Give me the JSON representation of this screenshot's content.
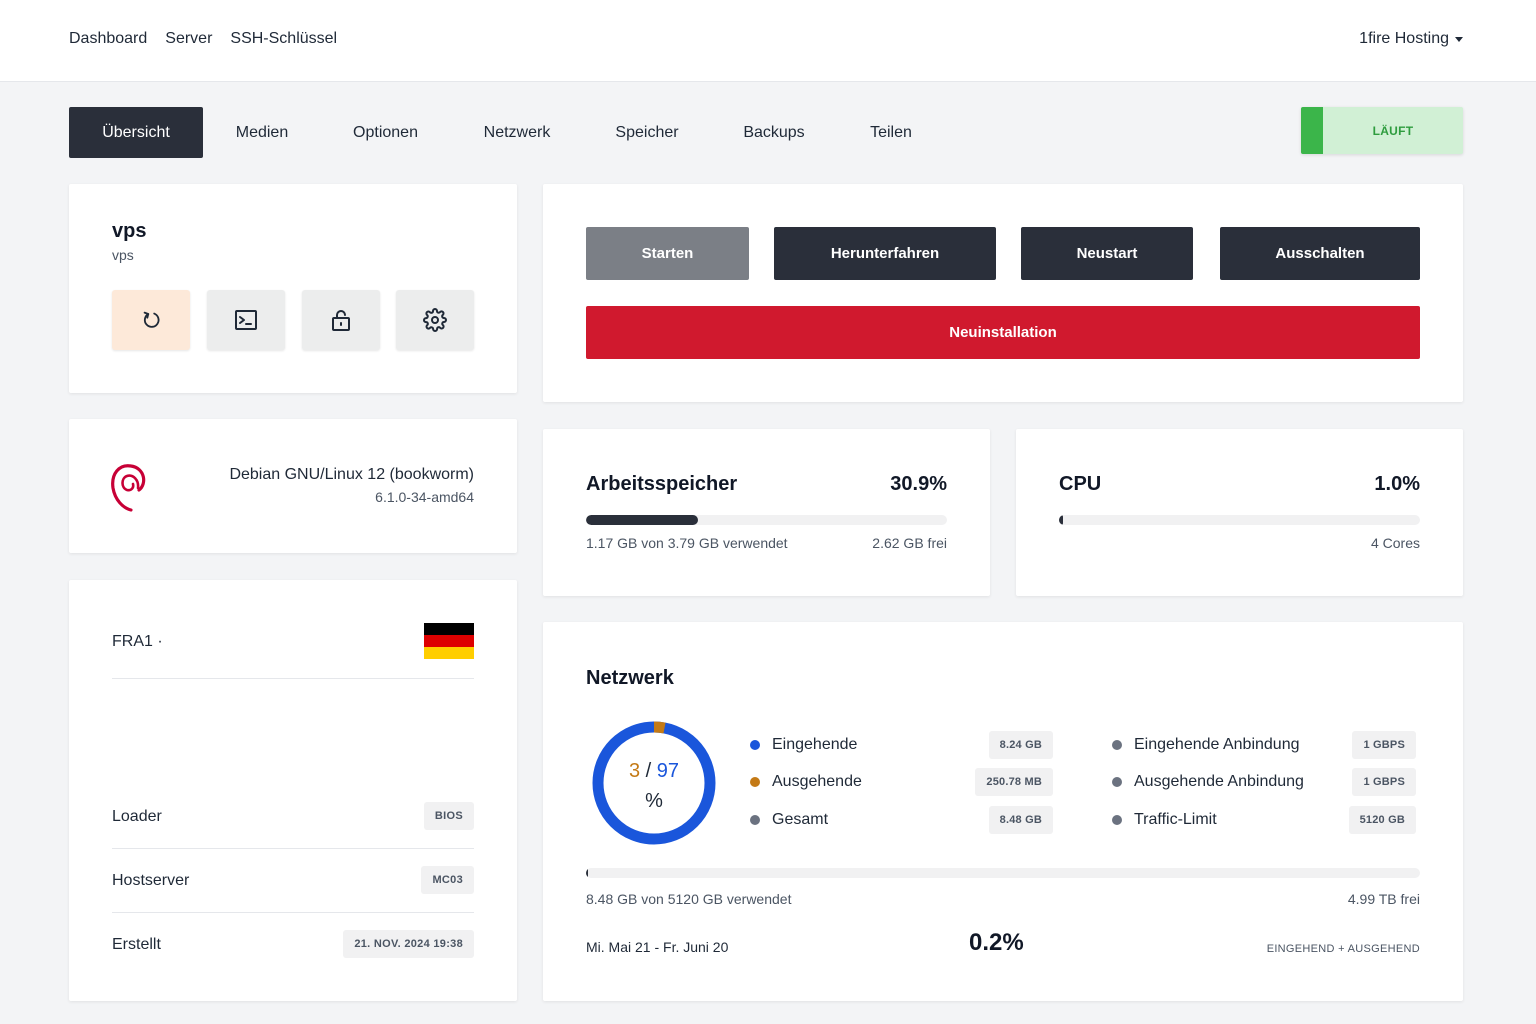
{
  "topnav": {
    "items": [
      "Dashboard",
      "Server",
      "SSH-Schlüssel"
    ],
    "account": "1fire Hosting"
  },
  "tabs": [
    "Übersicht",
    "Medien",
    "Optionen",
    "Netzwerk",
    "Speicher",
    "Backups",
    "Teilen"
  ],
  "status": "LÄUFT",
  "server": {
    "title": "vps",
    "subtitle": "vps",
    "actions": [
      "reinstall-icon",
      "console-icon",
      "lock-icon",
      "gear-icon"
    ]
  },
  "power": {
    "start": "Starten",
    "shutdown": "Herunterfahren",
    "restart": "Neustart",
    "poweroff": "Ausschalten",
    "reinstall": "Neuinstallation"
  },
  "os": {
    "name": "Debian GNU/Linux 12 (bookworm)",
    "kernel": "6.1.0-34-amd64"
  },
  "location": {
    "name": "FRA1 ·",
    "flag": "de"
  },
  "details": [
    {
      "label": "Loader",
      "value": "BIOS"
    },
    {
      "label": "Hostserver",
      "value": "MC03"
    },
    {
      "label": "Erstellt",
      "value": "21. NOV. 2024 19:38"
    }
  ],
  "memory": {
    "title": "Arbeitsspeicher",
    "percent": "30.9%",
    "fraction": 0.309,
    "used": "1.17 GB von 3.79 GB verwendet",
    "free": "2.62 GB frei"
  },
  "cpu": {
    "title": "CPU",
    "percent": "1.0%",
    "fraction": 0.01,
    "cores": "4 Cores"
  },
  "network": {
    "title": "Netzwerk",
    "donut": {
      "out_pct": "3",
      "sep": "/",
      "in_pct": "97",
      "unit": "%",
      "out_fraction": 0.03
    },
    "traffic": [
      {
        "label": "Eingehende",
        "value": "8.24 GB",
        "color": "#1a56db"
      },
      {
        "label": "Ausgehende",
        "value": "250.78 MB",
        "color": "#c47a16"
      },
      {
        "label": "Gesamt",
        "value": "8.48 GB",
        "color": "#6b7280"
      }
    ],
    "bandwidth": [
      {
        "label": "Eingehende Anbindung",
        "value": "1 GBPS",
        "color": "#6b7280"
      },
      {
        "label": "Ausgehende Anbindung",
        "value": "1 GBPS",
        "color": "#6b7280"
      },
      {
        "label": "Traffic-Limit",
        "value": "5120 GB",
        "color": "#6b7280"
      }
    ],
    "usage_fraction": 0.002,
    "used": "8.48 GB von 5120 GB verwendet",
    "free": "4.99 TB frei",
    "period": "Mi. Mai 21 - Fr. Juni 20",
    "percent": "0.2%",
    "direction": "EINGEHEND + AUSGEHEND"
  },
  "colors": {
    "dark": "#2a2f3a",
    "red": "#d0192e",
    "green": "#3bb54a",
    "blue": "#1a56db",
    "orange": "#c47a16"
  }
}
